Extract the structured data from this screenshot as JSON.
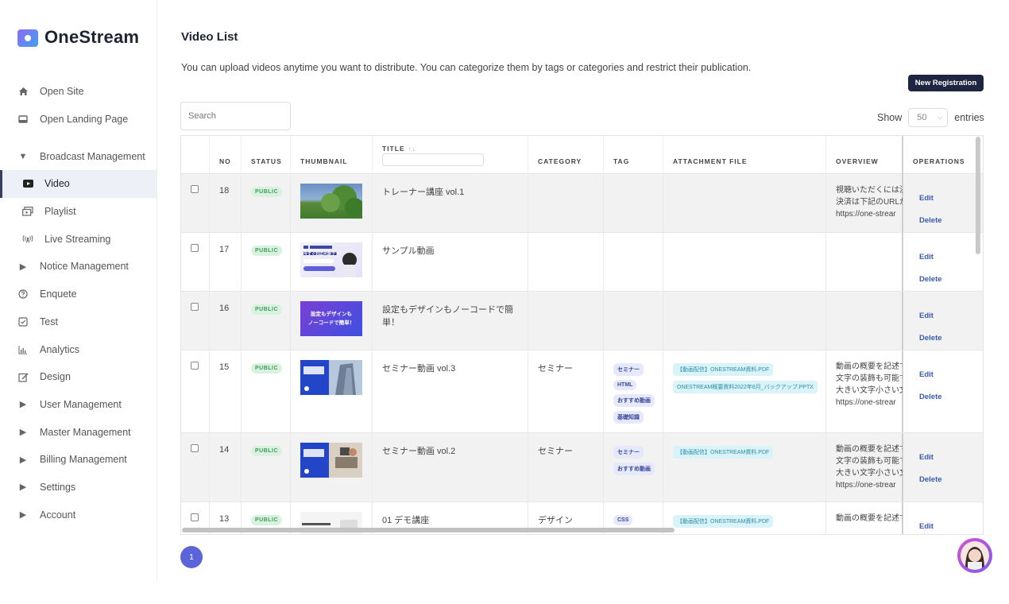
{
  "brand": {
    "name": "OneStream"
  },
  "sidebar": {
    "items": [
      {
        "label": "Open Site",
        "icon": "home-icon"
      },
      {
        "label": "Open Landing Page",
        "icon": "monitor-icon"
      },
      {
        "label": "Broadcast Management",
        "icon": "caret-down-icon"
      },
      {
        "label": "Video",
        "icon": "video-icon",
        "active": true
      },
      {
        "label": "Playlist",
        "icon": "playlist-icon"
      },
      {
        "label": "Live Streaming",
        "icon": "broadcast-icon"
      },
      {
        "label": "Notice Management",
        "icon": "caret-right-icon"
      },
      {
        "label": "Enquete",
        "icon": "question-icon"
      },
      {
        "label": "Test",
        "icon": "checkbox-icon"
      },
      {
        "label": "Analytics",
        "icon": "bar-chart-icon"
      },
      {
        "label": "Design",
        "icon": "edit-icon"
      },
      {
        "label": "User Management",
        "icon": "caret-right-icon"
      },
      {
        "label": "Master Management",
        "icon": "caret-right-icon"
      },
      {
        "label": "Billing Management",
        "icon": "caret-right-icon"
      },
      {
        "label": "Settings",
        "icon": "caret-right-icon"
      },
      {
        "label": "Account",
        "icon": "caret-right-icon"
      }
    ]
  },
  "main": {
    "title": "Video List",
    "description": "You can upload videos anytime you want to distribute. You can categorize them by tags or categories and restrict their publication.",
    "new_button": "New Registration",
    "search_placeholder": "Search",
    "show_label": "Show",
    "entries_value": "50",
    "entries_label": "entries",
    "pagination_current": "1"
  },
  "table": {
    "columns": [
      "NO",
      "STATUS",
      "THUMBNAIL",
      "TITLE",
      "CATEGORY",
      "TAG",
      "ATTACHMENT FILE",
      "OVERVIEW",
      "OPERATIONS"
    ],
    "sort_indicator": "↑↓",
    "rows": [
      {
        "no": "18",
        "status": "PUBLIC",
        "thumb": "tree-photo",
        "title": "トレーナー講座 vol.1",
        "category": "",
        "tags": [],
        "attachments": [],
        "overview": [
          "視聴いただくには決",
          "決済は下記のURLか",
          "https://one-strear"
        ],
        "edit": "Edit",
        "delete": "Delete"
      },
      {
        "no": "17",
        "status": "PUBLIC",
        "thumb": "onestream-banner",
        "thumb_title": "今すぐ対応可能です！",
        "title": "サンプル動画",
        "category": "",
        "tags": [],
        "attachments": [],
        "overview": [],
        "edit": "Edit",
        "delete": "Delete"
      },
      {
        "no": "16",
        "status": "PUBLIC",
        "thumb": "purple-text",
        "thumb_text": [
          "設定もデザインも",
          "ノーコードで簡単！"
        ],
        "title": "設定もデザインもノーコードで簡単！",
        "category": "",
        "tags": [],
        "attachments": [],
        "overview": [],
        "edit": "Edit",
        "delete": "Delete"
      },
      {
        "no": "15",
        "status": "PUBLIC",
        "thumb": "building-seminar",
        "title": "セミナー動画 vol.3",
        "category": "セミナー",
        "tags": [
          "セミナー",
          "HTML",
          "おすすめ動画",
          "基礎知識"
        ],
        "attachments": [
          "【動画配信】ONESTREAM資料.PDF",
          "ONESTREAM概要資料2022年8月_バックアップ.PPTX"
        ],
        "overview": [
          "動画の概要を記述で",
          "文字の装飾も可能で",
          "大きい文字小さい文",
          "https://one-strear"
        ],
        "edit": "Edit",
        "delete": "Delete"
      },
      {
        "no": "14",
        "status": "PUBLIC",
        "thumb": "desk-seminar",
        "title": "セミナー動画 vol.2",
        "category": "セミナー",
        "tags": [
          "セミナー",
          "おすすめ動画"
        ],
        "attachments": [
          "【動画配信】ONESTREAM資料.PDF"
        ],
        "overview": [
          "動画の概要を記述で",
          "文字の装飾も可能で",
          "大きい文字小さい文",
          "https://one-strear"
        ],
        "edit": "Edit",
        "delete": "Delete"
      },
      {
        "no": "13",
        "status": "PUBLIC",
        "thumb": "demo-lecture",
        "title": "01 デモ講座",
        "category": "デザイン",
        "tags": [
          "CSS"
        ],
        "attachments": [
          "【動画配信】ONESTREAM資料.PDF"
        ],
        "overview": [
          "動画の概要を記述で"
        ],
        "edit": "Edit",
        "delete": ""
      }
    ]
  },
  "colors": {
    "primary_dark": "#1e2540",
    "accent": "#5b64d8",
    "public_badge": "#3e9b5c",
    "link": "#3a5ab0"
  }
}
